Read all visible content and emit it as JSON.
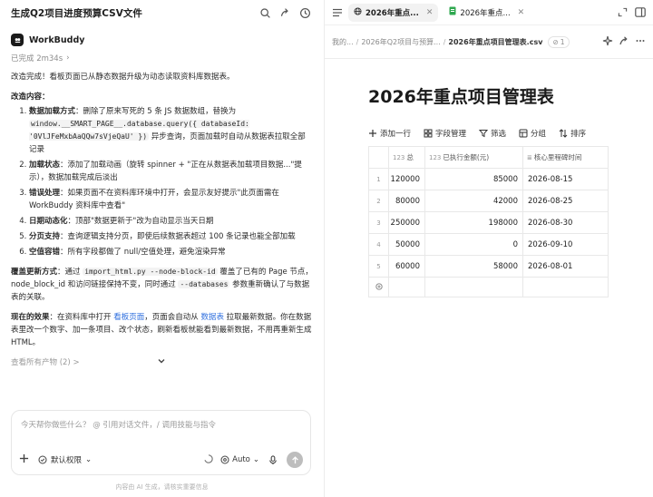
{
  "left_header": {
    "title": "生成Q2项目进度预算CSV文件",
    "icons": [
      "search-icon",
      "share-icon",
      "history-icon"
    ]
  },
  "agent": {
    "name": "WorkBuddy",
    "status": "已完成 2m34s"
  },
  "message": {
    "intro": "改造完成！看板页面已从静态数据升级为动态读取资料库数据表。",
    "content_heading": "改造内容：",
    "items": [
      {
        "label": "数据加载方式",
        "pre": "：删除了原来写死的 5 条 JS 数据数组，替换为 ",
        "code": "window.__SMART_PAGE__.database.query({ databaseId: '0VlJFeMxbAaQQw7sVjeQaU' })",
        "post": " 异步查询，页面加载时自动从数据表拉取全部记录"
      },
      {
        "label": "加载状态",
        "pre": "：添加了加载动画（旋转 spinner + \"正在从数据表加载项目数据...\"提示），数据加载完成后淡出",
        "code": "",
        "post": ""
      },
      {
        "label": "错误处理",
        "pre": "：如果页面不在资料库环境中打开，会显示友好提示\"此页面需在 WorkBuddy 资料库中查看\"",
        "code": "",
        "post": ""
      },
      {
        "label": "日期动态化",
        "pre": "：顶部\"数据更新于\"改为自动显示当天日期",
        "code": "",
        "post": ""
      },
      {
        "label": "分页支持",
        "pre": "：查询逻辑支持分页，即使后续数据表超过 100 条记录也能全部加载",
        "code": "",
        "post": ""
      },
      {
        "label": "空值容错",
        "pre": "：所有字段都做了 null/空值处理，避免渲染异常",
        "code": "",
        "post": ""
      }
    ],
    "overwrite": {
      "label": "覆盖更新方式",
      "t1": "：通过 ",
      "code1": "import_html.py --node-block-id",
      "t2": " 覆盖了已有的 Page 节点，node_block_id 和访问链接保持不变，同时通过 ",
      "code2": "--databases",
      "t3": " 参数重新确认了与数据表的关联。"
    },
    "effect": {
      "label": "现在的效果",
      "t1": "：在资料库中打开 ",
      "link1": "看板页面",
      "t2": "，页面会自动从 ",
      "link2": "数据表",
      "t3": " 拉取最新数据。你在数据表里改一个数字、加一条项目、改个状态，刷新看板就能看到最新数据，不用再重新生成 HTML。"
    },
    "artifacts": "查看所有产物 (2) >"
  },
  "composer": {
    "placeholder": "今天帮你做些什么？ @ 引用对话文件，/ 调用技能与指令",
    "permission": "默认权限",
    "mode": "Auto",
    "footer": "内容由 AI 生成，请核实重要信息"
  },
  "tabs": [
    {
      "label": "2026年重点...",
      "icon": "globe-icon",
      "active": true
    },
    {
      "label": "2026年重点...",
      "icon": "sheet-icon",
      "active": false
    }
  ],
  "breadcrumb": {
    "items": [
      "我的...",
      "2026年Q2项目与预算...",
      "2026年重点项目管理表.csv"
    ],
    "badge": "1"
  },
  "document": {
    "title": "2026年重点项目管理表",
    "toolbar": [
      "添加一行",
      "字段管理",
      "筛选",
      "分组",
      "排序"
    ],
    "columns": [
      "总",
      "已执行金额(元)",
      "核心里程碑时间"
    ],
    "rows": [
      {
        "n": "1",
        "total": "120000",
        "spent": "85000",
        "date": "2026-08-15"
      },
      {
        "n": "2",
        "total": "80000",
        "spent": "42000",
        "date": "2026-08-25"
      },
      {
        "n": "3",
        "total": "250000",
        "spent": "198000",
        "date": "2026-08-30"
      },
      {
        "n": "4",
        "total": "50000",
        "spent": "0",
        "date": "2026-09-10"
      },
      {
        "n": "5",
        "total": "60000",
        "spent": "58000",
        "date": "2026-08-01"
      }
    ]
  }
}
